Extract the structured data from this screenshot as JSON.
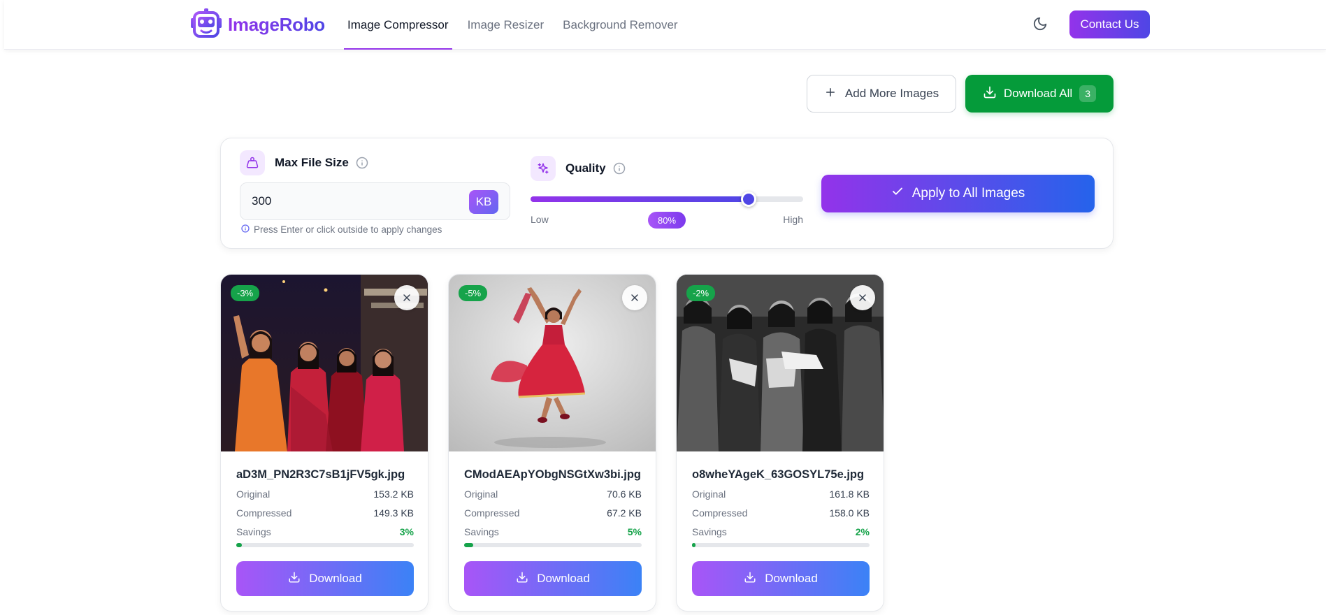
{
  "header": {
    "logo_text": "ImageRobo",
    "nav": [
      "Image Compressor",
      "Image Resizer",
      "Background Remover"
    ],
    "active_nav": 0,
    "contact_label": "Contact Us",
    "theme_icon": "moon-icon",
    "accent": "#9333ea"
  },
  "actions": {
    "add_label": "Add More Images",
    "download_all_label": "Download All",
    "download_count": "3",
    "download_all_color": "#059b3a"
  },
  "settings": {
    "max_size_label": "Max File Size",
    "max_size_value": "300",
    "unit": "KB",
    "hint": "Press Enter or click outside to apply changes",
    "quality_label": "Quality",
    "quality_value": 80,
    "quality_text": "80%",
    "low_label": "Low",
    "high_label": "High",
    "apply_label": "Apply to All Images"
  },
  "cards": [
    {
      "badge": "-3%",
      "filename": "aD3M_PN2R3C7sB1jFV5gk.jpg",
      "original_label": "Original",
      "original": "153.2 KB",
      "compressed_label": "Compressed",
      "compressed": "149.3 KB",
      "savings_label": "Savings",
      "savings": "3%",
      "savings_value": 3,
      "download_label": "Download"
    },
    {
      "badge": "-5%",
      "filename": "CModAEApYObgNSGtXw3bi.jpg",
      "original_label": "Original",
      "original": "70.6 KB",
      "compressed_label": "Compressed",
      "compressed": "67.2 KB",
      "savings_label": "Savings",
      "savings": "5%",
      "savings_value": 5,
      "download_label": "Download"
    },
    {
      "badge": "-2%",
      "filename": "o8wheYAgeK_63GOSYL75e.jpg",
      "original_label": "Original",
      "original": "161.8 KB",
      "compressed_label": "Compressed",
      "compressed": "158.0 KB",
      "savings_label": "Savings",
      "savings": "2%",
      "savings_value": 2,
      "download_label": "Download"
    }
  ]
}
